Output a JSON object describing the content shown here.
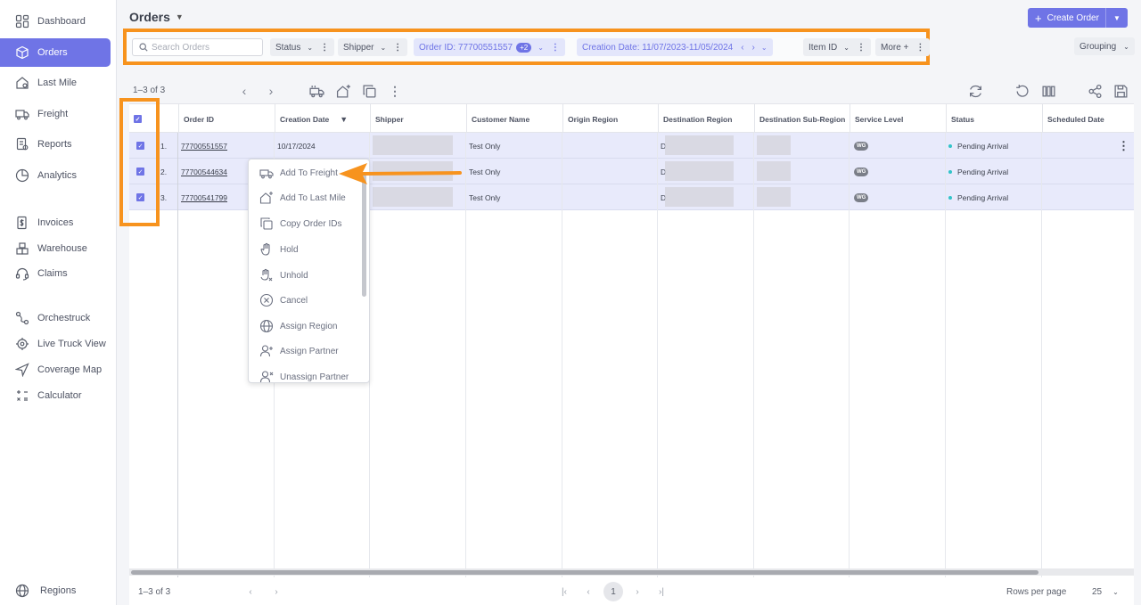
{
  "sidebar": {
    "items": [
      {
        "label": "Dashboard",
        "icon": "dashboard-icon"
      },
      {
        "label": "Orders",
        "icon": "box-icon",
        "active": true
      },
      {
        "label": "Last Mile",
        "icon": "house-icon"
      },
      {
        "label": "Freight",
        "icon": "truck-icon"
      },
      {
        "label": "Reports",
        "icon": "report-icon"
      },
      {
        "label": "Analytics",
        "icon": "analytics-icon"
      },
      {
        "label": "Invoices",
        "icon": "invoice-icon"
      },
      {
        "label": "Warehouse",
        "icon": "warehouse-icon"
      },
      {
        "label": "Claims",
        "icon": "headset-icon"
      },
      {
        "label": "Orchestruck",
        "icon": "route-icon"
      },
      {
        "label": "Live Truck View",
        "icon": "target-icon"
      },
      {
        "label": "Coverage Map",
        "icon": "navigation-icon"
      },
      {
        "label": "Calculator",
        "icon": "calculator-icon"
      }
    ],
    "bottom": {
      "label": "Regions",
      "icon": "globe-icon"
    }
  },
  "header": {
    "title": "Orders",
    "create_label": "Create Order"
  },
  "filters": {
    "search_placeholder": "Search Orders",
    "status": "Status",
    "shipper": "Shipper",
    "order_id": "Order ID: 77700551557",
    "order_id_badge": "+2",
    "creation_date": "Creation Date: 11/07/2023-11/05/2024",
    "item_id": "Item ID",
    "more": "More +",
    "grouping": "Grouping"
  },
  "table": {
    "count": "1–3 of 3",
    "columns": [
      "Order ID",
      "Creation Date",
      "Shipper",
      "Customer Name",
      "Origin Region",
      "Destination Region",
      "Destination Sub-Region",
      "Service Level",
      "Status",
      "Scheduled Date"
    ],
    "rows": [
      {
        "num": "1.",
        "order_id": "77700551557",
        "creation_date": "10/17/2024",
        "customer": "Test Only",
        "dest_prefix": "D",
        "service": "WG",
        "status": "Pending Arrival"
      },
      {
        "num": "2.",
        "order_id": "77700544634",
        "creation_date": "",
        "customer": "Test Only",
        "dest_prefix": "D",
        "service": "WG",
        "status": "Pending Arrival"
      },
      {
        "num": "3.",
        "order_id": "77700541799",
        "creation_date": "",
        "customer": "Test Only",
        "dest_prefix": "D",
        "service": "WG",
        "status": "Pending Arrival"
      }
    ]
  },
  "context_menu": {
    "items": [
      {
        "label": "Add To Freight",
        "icon": "truck-icon"
      },
      {
        "label": "Add To Last Mile",
        "icon": "house-plus-icon"
      },
      {
        "label": "Copy Order IDs",
        "icon": "copy-icon"
      },
      {
        "label": "Hold",
        "icon": "hand-icon"
      },
      {
        "label": "Unhold",
        "icon": "hand-x-icon"
      },
      {
        "label": "Cancel",
        "icon": "circle-x-icon"
      },
      {
        "label": "Assign Region",
        "icon": "globe-icon"
      },
      {
        "label": "Assign Partner",
        "icon": "user-plus-icon"
      },
      {
        "label": "Unassign Partner",
        "icon": "user-x-icon"
      }
    ]
  },
  "footer": {
    "count": "1–3 of 3",
    "page": "1",
    "rows_per_page_label": "Rows per page",
    "rows_per_page_value": "25"
  },
  "colors": {
    "accent": "#6f74e6",
    "highlight": "#f7931e",
    "selected_row": "#e8eafb",
    "status_dot": "#31c4c9"
  }
}
